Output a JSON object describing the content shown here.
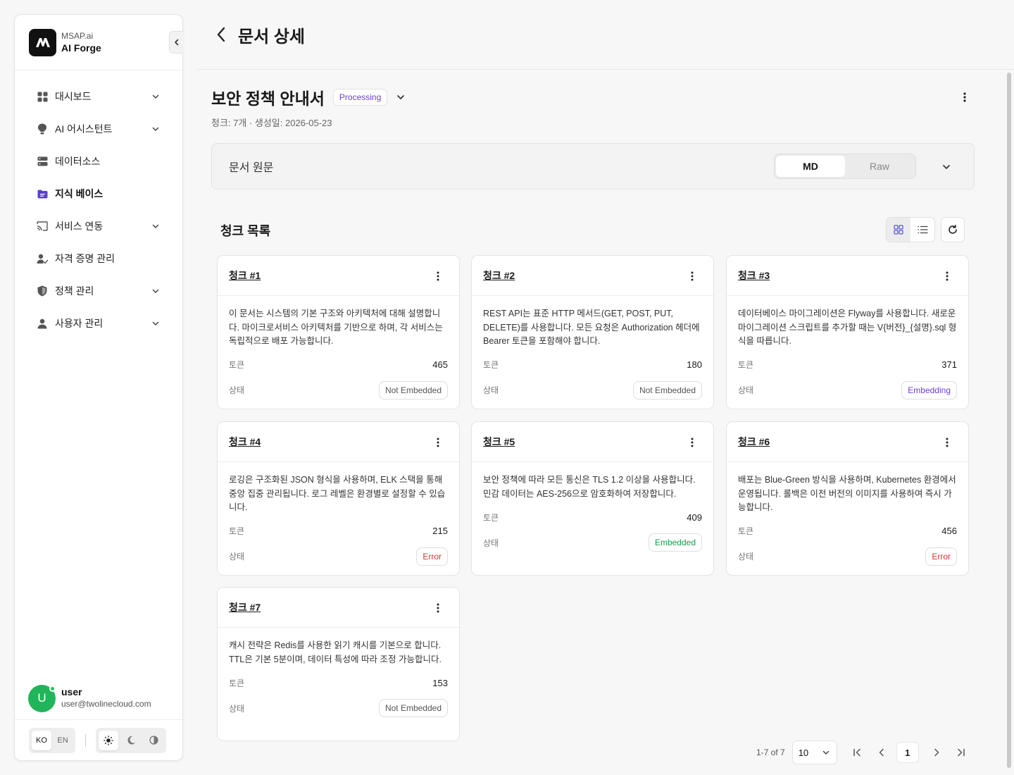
{
  "brand": {
    "sub": "MSAP.ai",
    "title": "AI Forge"
  },
  "sidebar": {
    "items": [
      {
        "label": "대시보드",
        "icon": "grid-icon",
        "expandable": true,
        "active": false
      },
      {
        "label": "AI 어시스턴트",
        "icon": "lightbulb-icon",
        "expandable": true,
        "active": false
      },
      {
        "label": "데이터소스",
        "icon": "server-icon",
        "expandable": false,
        "active": false
      },
      {
        "label": "지식 베이스",
        "icon": "folder-icon",
        "expandable": false,
        "active": true
      },
      {
        "label": "서비스 연동",
        "icon": "cast-icon",
        "expandable": true,
        "active": false
      },
      {
        "label": "자격 증명 관리",
        "icon": "user-check-icon",
        "expandable": false,
        "active": false
      },
      {
        "label": "정책 관리",
        "icon": "shield-icon",
        "expandable": true,
        "active": false
      },
      {
        "label": "사용자 관리",
        "icon": "user-icon",
        "expandable": true,
        "active": false
      }
    ]
  },
  "user": {
    "initial": "U",
    "name": "user",
    "email": "user@twolinecloud.com"
  },
  "footer": {
    "lang_ko": "KO",
    "lang_en": "EN"
  },
  "header": {
    "title": "문서 상세"
  },
  "document": {
    "title": "보안 정책 안내서",
    "status": "Processing",
    "meta": "청크: 7개 · 생성일: 2026-05-23"
  },
  "source": {
    "label": "문서 원문",
    "tab_md": "MD",
    "tab_raw": "Raw"
  },
  "chunks_section": {
    "title": "청크 목록",
    "token_label": "토큰",
    "state_label": "상태"
  },
  "chunks": [
    {
      "title": "청크 #1",
      "text": "이 문서는 시스템의 기본 구조와 아키텍처에 대해 설명합니다. 마이크로서비스 아키텍처를 기반으로 하며, 각 서비스는 독립적으로 배포 가능합니다.",
      "tokens": "465",
      "status": "Not Embedded",
      "status_type": "ne"
    },
    {
      "title": "청크 #2",
      "text": "REST API는 표준 HTTP 메서드(GET, POST, PUT, DELETE)를 사용합니다. 모든 요청은 Authorization 헤더에 Bearer 토큰을 포함해야 합니다.",
      "tokens": "180",
      "status": "Not Embedded",
      "status_type": "ne"
    },
    {
      "title": "청크 #3",
      "text": "데이터베이스 마이그레이션은 Flyway를 사용합니다. 새로운 마이그레이션 스크립트를 추가할 때는 V{버전}_{설명}.sql 형식을 따릅니다.",
      "tokens": "371",
      "status": "Embedding",
      "status_type": "embedding"
    },
    {
      "title": "청크 #4",
      "text": "로깅은 구조화된 JSON 형식을 사용하며, ELK 스택을 통해 중앙 집중 관리됩니다. 로그 레벨은 환경별로 설정할 수 있습니다.",
      "tokens": "215",
      "status": "Error",
      "status_type": "error"
    },
    {
      "title": "청크 #5",
      "text": "보안 정책에 따라 모든 통신은 TLS 1.2 이상을 사용합니다. 민감 데이터는 AES-256으로 암호화하여 저장합니다.",
      "tokens": "409",
      "status": "Embedded",
      "status_type": "embedded"
    },
    {
      "title": "청크 #6",
      "text": "배포는 Blue-Green 방식을 사용하며, Kubernetes 환경에서 운영됩니다. 롤백은 이전 버전의 이미지를 사용하여 즉시 가능합니다.",
      "tokens": "456",
      "status": "Error",
      "status_type": "error"
    },
    {
      "title": "청크 #7",
      "text": "캐시 전략은 Redis를 사용한 읽기 캐시를 기본으로 합니다. TTL은 기본 5분이며, 데이터 특성에 따라 조정 가능합니다.",
      "tokens": "153",
      "status": "Not Embedded",
      "status_type": "ne"
    }
  ],
  "pagination": {
    "info": "1-7 of 7",
    "page_size": "10",
    "current_page": "1"
  },
  "colors": {
    "accent": "#6b3fd6",
    "embedded": "#1a9d4b",
    "error": "#d53333",
    "avatar": "#22b45a"
  }
}
